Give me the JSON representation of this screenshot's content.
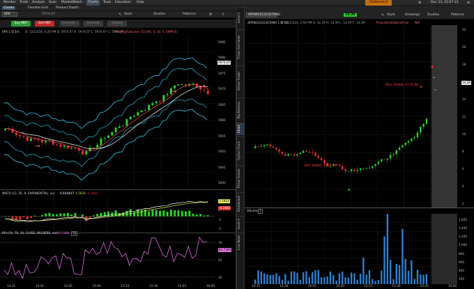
{
  "menu": {
    "items": [
      "Monitor",
      "Trade",
      "Analyze",
      "Scan",
      "MarketWatch",
      "Charts",
      "Tools",
      "Education",
      "Help"
    ],
    "ondemand": "OnDemand",
    "datetime": "Dec 23, 16:07:31"
  },
  "left_toolbar": {
    "charts": "Charts",
    "flexible_grid": "Flexible Grid",
    "product_depth": "Product Depth",
    "symbol": "SPX",
    "last": "5974.07",
    "style": "Style",
    "studies": "Studies",
    "patterns": "Patterns",
    "buy": "Buy MKT",
    "sell": "Sell MKT",
    "connect": "Connect...",
    "reverse": "Reverse",
    "flatten": "Flatten"
  },
  "left_header": {
    "symbol": "SPX 1 D 5m",
    "ohlc": "D: 12/23/24, 4:20 PM  O: 5974.07  H: 5974.07  L: 5974.07  C: 5974.07",
    "study": "MovAvgTwoLines (CLOSE, 5, 10, 0, SIMPLE)"
  },
  "price_chart": {
    "yticks": [
      "5985",
      "5980",
      "5975",
      "5970",
      "5965",
      "5960",
      "5955",
      "5950",
      "5945",
      "5940"
    ],
    "last_price": "5974.07"
  },
  "macd": {
    "label": "MACD (12, 26, 9, EXPONENTIAL, no)",
    "value1": "0.934447",
    "value2": "1.1933",
    "value3": "-0.2483",
    "yticks": [
      "2",
      "0",
      "-2",
      "-4"
    ],
    "tag1": "1.1933",
    "tag2": "-0.2483"
  },
  "rsi": {
    "label": "RSI (14, 70, 30, CLOSE, WILDERS, no)",
    "value": "61.7394",
    "ob": "70",
    "os": "30",
    "yticks": [
      "70",
      "50",
      "30"
    ],
    "tag_value": "61.7394"
  },
  "xticks_left": [
    "14:15",
    "14:30",
    "14:45",
    "15:00",
    "15:15",
    "15:30",
    "15:45",
    "16:00"
  ],
  "right_toolbar": {
    "symbol": "SPXW241223C5960",
    "last": "14.39",
    "style": "Style",
    "drawings": "Drawings",
    "studies": "Studies",
    "patterns": "Patterns"
  },
  "right_header": {
    "symbol": ".SPXW241223C5960 1 D 5m",
    "ohlc": "D: 12/23/24, 3:59 PM  O: 14.39  H: 14.39  L: 14.39  C: 14.39",
    "study": "TheoreticalOptionPrice",
    "study_value": "N/A"
  },
  "option_chart": {
    "yticks": [
      "22",
      "20",
      "18",
      "16",
      "14",
      "12",
      "10",
      "8",
      "6",
      "4",
      "2"
    ],
    "last_price": "14.39",
    "sell_signal": "SELL SIGNAL 47.15 KB",
    "buy_signal": "BUY SIGNAL 47.15 KB"
  },
  "volume": {
    "label": "Volume",
    "value": "2",
    "yticks": [
      "1,600",
      "1,400",
      "1,200",
      "1,000",
      "800",
      "600",
      "400",
      "200"
    ]
  },
  "xticks_right": [
    "14:15",
    "14:30",
    "14:45",
    "15:00",
    "15:15",
    "15:30",
    "15:45",
    "16:00"
  ],
  "side_tabs": [
    "Level II",
    "Times And Sales",
    "Active Trader",
    "Big Buttons",
    "Chart",
    "Option Chain",
    "Phase Scores",
    "Dashboard",
    "Level II",
    "Live News"
  ],
  "colors": {
    "up": "#2bd12b",
    "down": "#e03030",
    "ma_fast": "#ff5050",
    "ma_slow": "#ffffff",
    "band": "#35c8e8",
    "rsi": "#e070e0",
    "macd_line": "#ffffff",
    "signal_line": "#e8e850",
    "volume": "#2f7fd0"
  }
}
